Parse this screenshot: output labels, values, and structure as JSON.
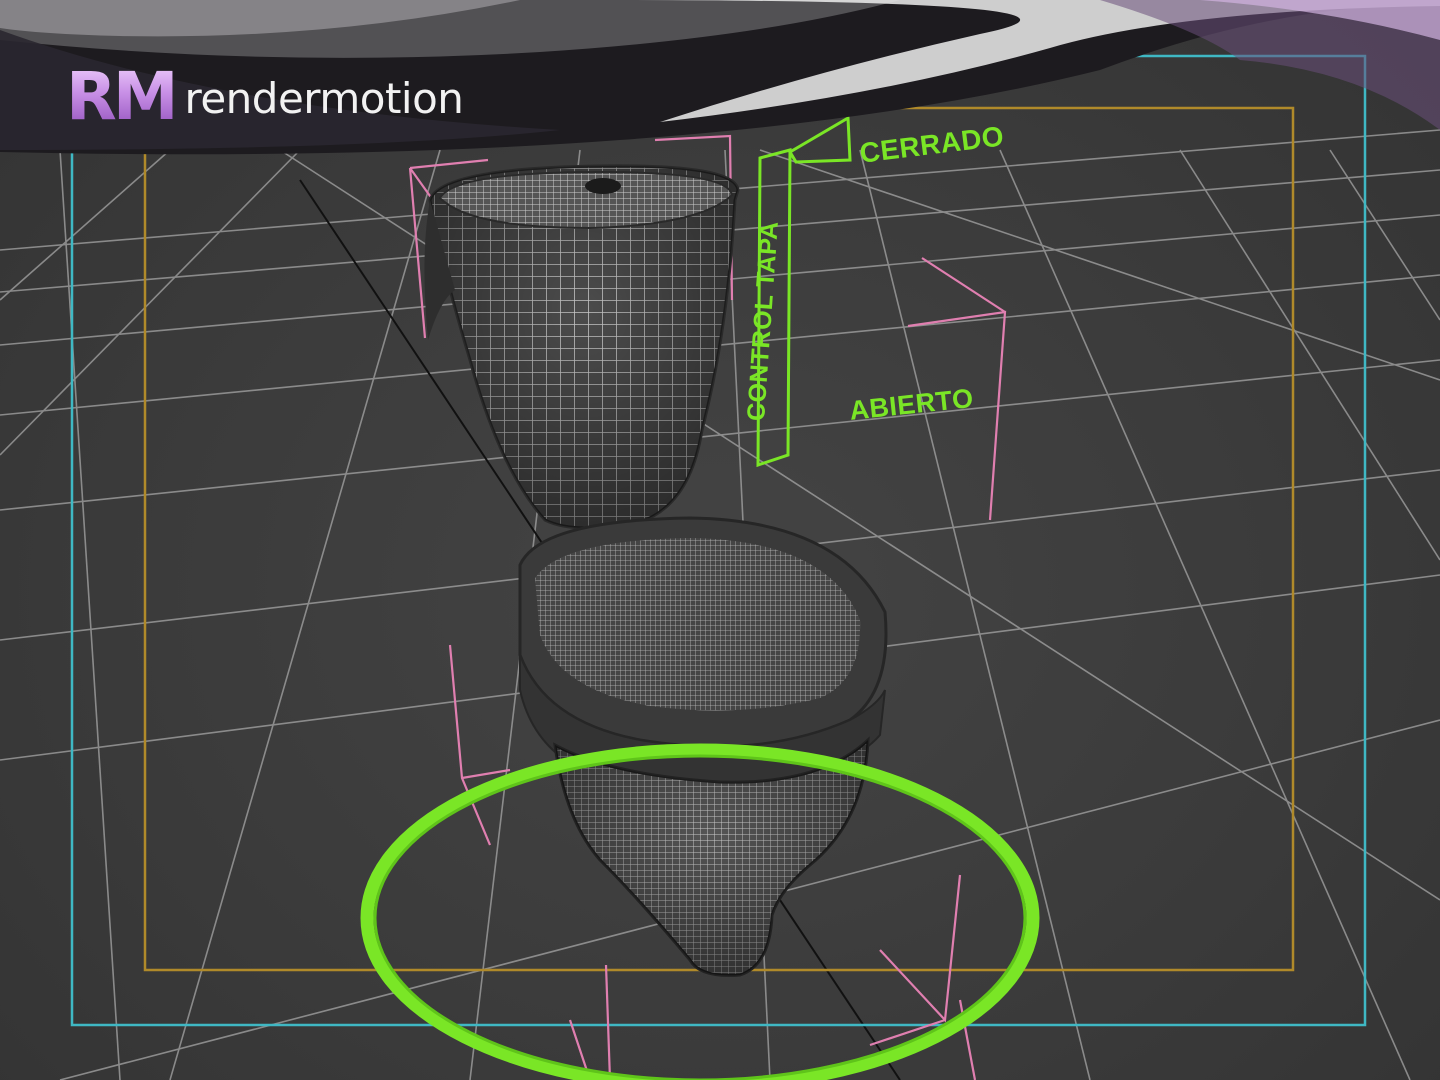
{
  "brand": {
    "logo_mark": "RM",
    "logo_text": "rendermotion"
  },
  "scene": {
    "object": "toilet-wireframe-model",
    "labels": {
      "cerrado": "CERRADO",
      "abierto": "ABIERTO",
      "control": "CONTROL TAPA"
    }
  },
  "colors": {
    "viewport_background": "#3a3a3a",
    "grid": "#9a9a9a",
    "safe_frame_outer": "#3fb8c4",
    "safe_frame_inner": "#b08a2a",
    "control_shape": "#7ae626",
    "helper_lines": "#e07fb0",
    "mesh": "#bfbfbf"
  }
}
